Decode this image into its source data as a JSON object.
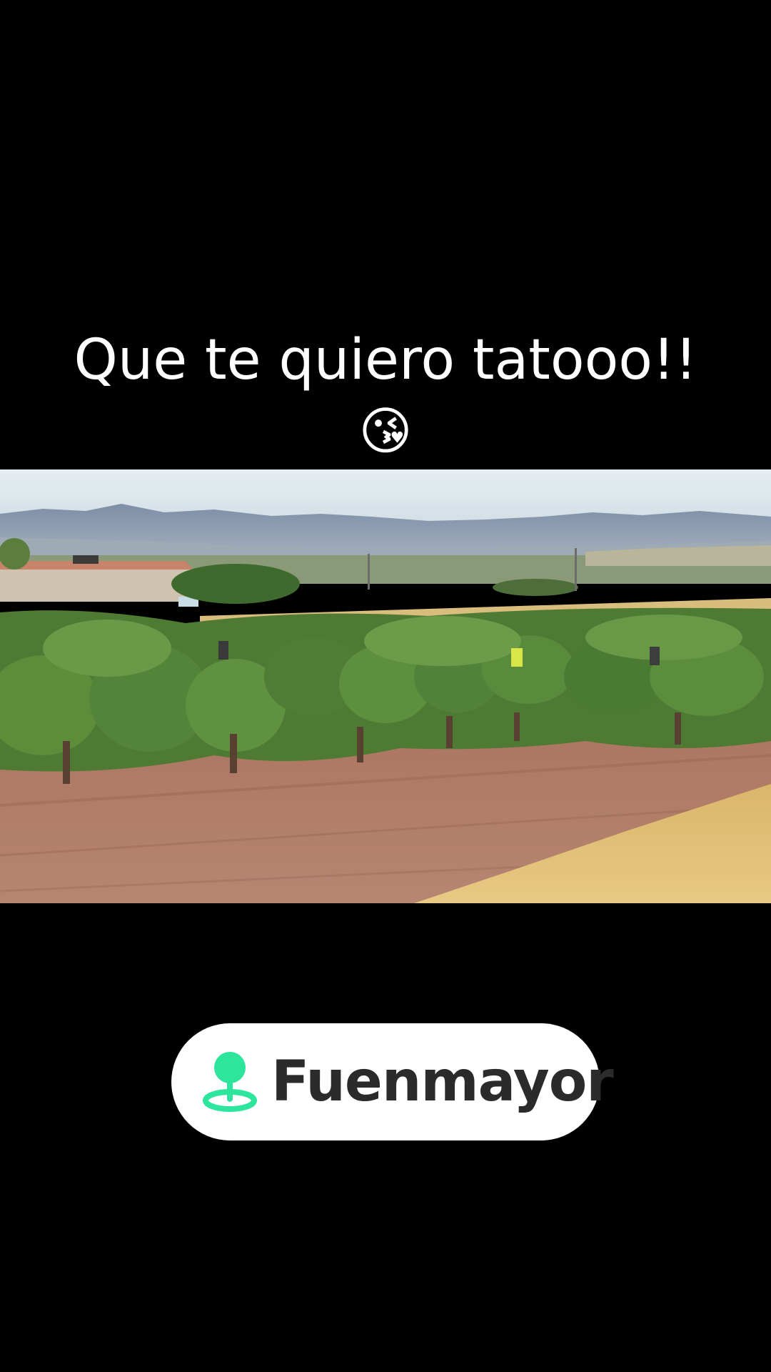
{
  "caption": {
    "line1": "Que te quiero tatooo!!",
    "emoji": "😘"
  },
  "photo": {
    "subject": "vineyard"
  },
  "location_sticker": {
    "icon": "location-pin-icon",
    "label": "Fuenmayor",
    "icon_color": "#2ee59d",
    "text_color": "#2b2b2b",
    "background": "#ffffff"
  }
}
